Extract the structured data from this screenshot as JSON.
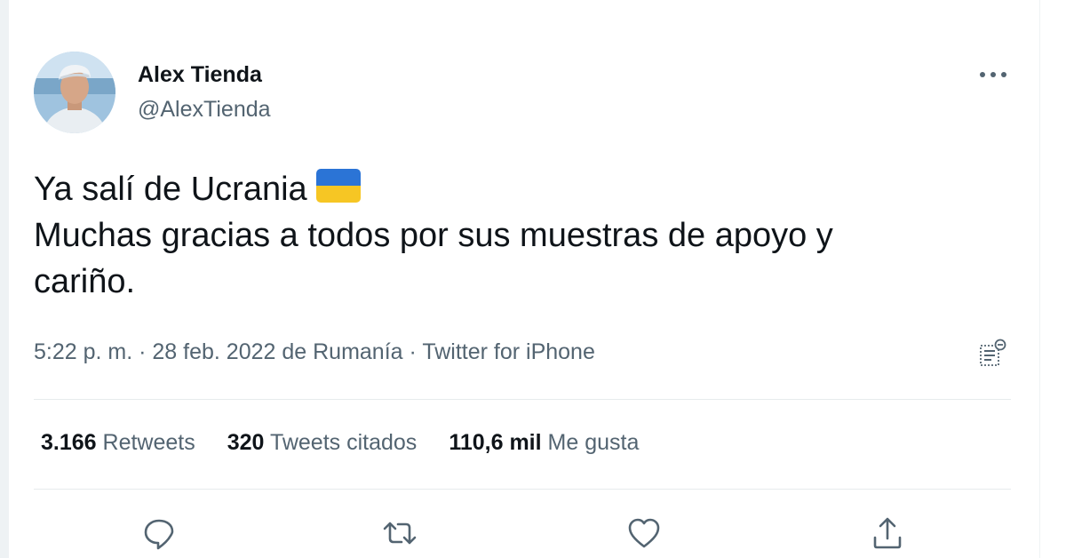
{
  "author": {
    "name": "Alex Tienda",
    "handle": "@AlexTienda"
  },
  "tweet": {
    "line1": "Ya salí de Ucrania",
    "line2": "Muchas gracias a todos por sus muestras de apoyo y",
    "line3": "cariño.",
    "flag": "ukraine-flag-emoji"
  },
  "meta": {
    "time": "5:22 p. m.",
    "sep1": " · ",
    "date": "28 feb. 2022",
    "location_prefix": " de ",
    "location": "Rumanía",
    "sep2": " · ",
    "source": "Twitter for iPhone"
  },
  "stats": {
    "retweets_count": "3.166",
    "retweets_label": "Retweets",
    "quotes_count": "320",
    "quotes_label": "Tweets citados",
    "likes_count": "110,6 mil",
    "likes_label": "Me gusta"
  },
  "icons": {
    "more": "more-horizontal-icon",
    "analytics": "analytics-icon",
    "reply": "reply-icon",
    "retweet": "retweet-icon",
    "like": "heart-icon",
    "share": "share-icon"
  },
  "colors": {
    "text": "#0f1419",
    "secondary": "#536471",
    "divider": "#e7ebed",
    "flag_blue": "#2b74d6",
    "flag_yellow": "#f6c624"
  }
}
